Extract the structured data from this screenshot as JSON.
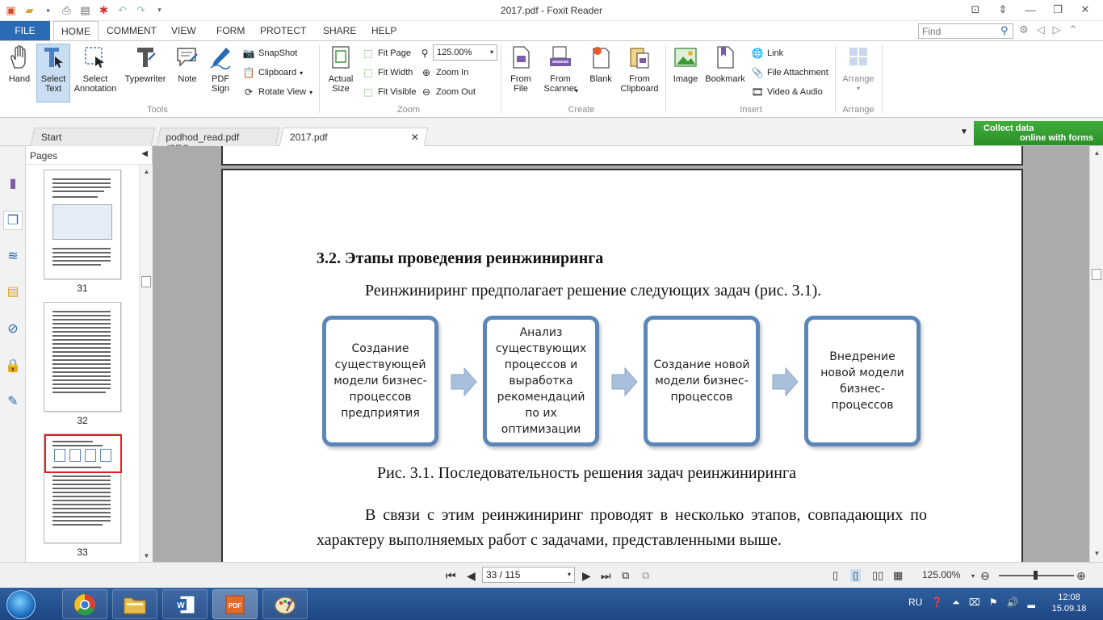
{
  "window": {
    "title": "2017.pdf - Foxit Reader"
  },
  "ribbon_tabs": {
    "file": "FILE",
    "items": [
      "HOME",
      "COMMENT",
      "VIEW",
      "FORM",
      "PROTECT",
      "SHARE",
      "HELP"
    ],
    "active": "HOME"
  },
  "search": {
    "placeholder": "Find"
  },
  "ribbon": {
    "tools": {
      "label": "Tools",
      "hand": "Hand",
      "select_text": [
        "Select",
        "Text"
      ],
      "select_annotation": [
        "Select",
        "Annotation"
      ],
      "typewriter": "Typewriter",
      "note": "Note",
      "pdf_sign": [
        "PDF",
        "Sign"
      ],
      "snapshot": "SnapShot",
      "clipboard": "Clipboard",
      "rotate_view": "Rotate View"
    },
    "zoom": {
      "label": "Zoom",
      "actual_size": [
        "Actual",
        "Size"
      ],
      "fit_page": "Fit Page",
      "fit_width": "Fit Width",
      "fit_visible": "Fit Visible",
      "zoom_value": "125.00%",
      "zoom_in": "Zoom In",
      "zoom_out": "Zoom Out"
    },
    "create": {
      "label": "Create",
      "from_file": [
        "From",
        "File"
      ],
      "from_scanner": [
        "From",
        "Scanner"
      ],
      "blank": "Blank",
      "from_clipboard": [
        "From",
        "Clipboard"
      ]
    },
    "insert": {
      "label": "Insert",
      "image": "Image",
      "bookmark": "Bookmark",
      "link": "Link",
      "file_attachment": "File Attachment",
      "video_audio": "Video & Audio"
    },
    "arrange": {
      "label": "Arrange",
      "arrange": "Arrange"
    }
  },
  "doc_tabs": [
    "Start",
    "podhod_read.pdf (SEC...",
    "2017.pdf"
  ],
  "collect_banner": [
    "Collect data",
    "online with forms"
  ],
  "pages_panel": {
    "title": "Pages",
    "thumbnails": [
      "31",
      "32",
      "33"
    ]
  },
  "document": {
    "heading": "3.2.  Этапы проведения реинжиниринга",
    "intro": "Реинжиниринг предполагает решение следующих задач (рис. 3.1).",
    "flow_boxes": [
      "Создание существующей модели бизнес-процессов предприятия",
      "Анализ существующих процессов и выработка рекомендаций по их оптимизации",
      "Создание новой модели бизнес-процессов",
      "Внедрение новой модели бизнес-процессов"
    ],
    "caption": "Рис. 3.1. Последовательность решения задач реинжиниринга",
    "body": "В связи с этим реинжиниринг проводят в несколько этапов, совпадающих по характеру выполняемых работ с задачами, представленными выше."
  },
  "statusbar": {
    "page_indicator": "33 / 115",
    "zoom": "125.00%"
  },
  "taskbar": {
    "language": "RU",
    "time": "12:08",
    "date": "15.09.18"
  },
  "colors": {
    "accent": "#2a6bb6",
    "flow_border": "#5b86b8",
    "flow_arrow": "#a9c0dd",
    "selection": "#e02020",
    "banner": "#3fae3a"
  }
}
